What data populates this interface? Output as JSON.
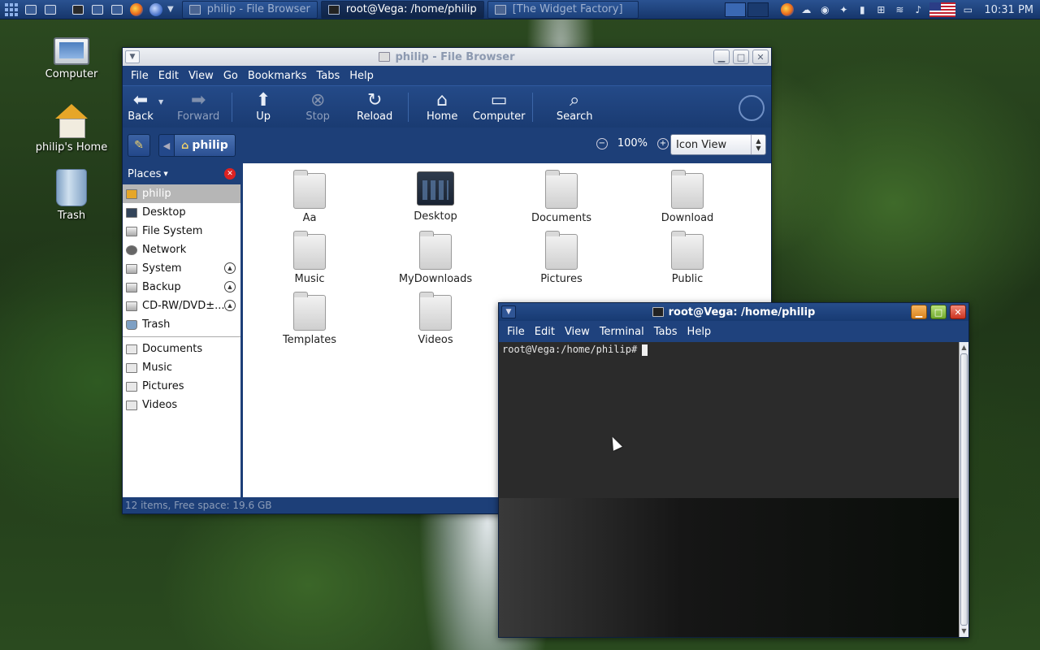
{
  "panel": {
    "tasks": [
      {
        "label": "philip - File Browser",
        "active": false
      },
      {
        "label": "root@Vega: /home/philip",
        "active": true
      },
      {
        "label": "[The Widget Factory]",
        "active": false
      }
    ],
    "clock": "10:31 PM"
  },
  "desktop": {
    "icons": [
      "Computer",
      "philip's Home",
      "Trash"
    ]
  },
  "file_browser": {
    "title": "philip - File Browser",
    "menu": [
      "File",
      "Edit",
      "View",
      "Go",
      "Bookmarks",
      "Tabs",
      "Help"
    ],
    "toolbar": {
      "back": "Back",
      "forward": "Forward",
      "up": "Up",
      "stop": "Stop",
      "reload": "Reload",
      "home": "Home",
      "computer": "Computer",
      "search": "Search"
    },
    "location": {
      "crumb": "philip",
      "zoom": "100%",
      "view_mode": "Icon View"
    },
    "places": {
      "header": "Places",
      "items": [
        "philip",
        "Desktop",
        "File System",
        "Network",
        "System",
        "Backup",
        "CD-RW/DVD±...",
        "Trash"
      ],
      "bookmarks": [
        "Documents",
        "Music",
        "Pictures",
        "Videos"
      ]
    },
    "files": [
      "Aa",
      "Desktop",
      "Documents",
      "Download",
      "Music",
      "MyDownloads",
      "Pictures",
      "Public",
      "Templates",
      "Videos"
    ],
    "status": "12 items, Free space: 19.6 GB"
  },
  "terminal": {
    "title": "root@Vega: /home/philip",
    "menu": [
      "File",
      "Edit",
      "View",
      "Terminal",
      "Tabs",
      "Help"
    ],
    "prompt": "root@Vega:/home/philip#"
  }
}
